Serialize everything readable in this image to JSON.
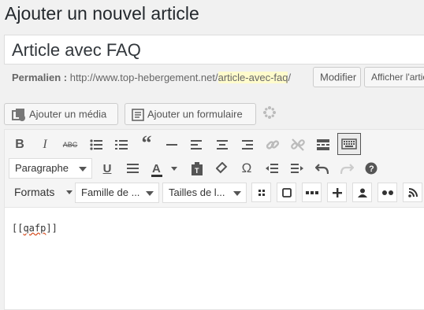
{
  "page_title": "Ajouter un nouvel article",
  "post_title": "Article avec FAQ",
  "permalink": {
    "label": "Permalien :",
    "base": "http://www.top-hebergement.net/",
    "slug": "article-avec-faq",
    "trailing": "/",
    "edit_button": "Modifier",
    "view_button": "Afficher l'article"
  },
  "media": {
    "add_media": "Ajouter un média",
    "add_form": "Ajouter un formulaire"
  },
  "toolbar": {
    "row1_icons": [
      "bold-icon",
      "italic-icon",
      "strikethrough-icon",
      "bullet-list-icon",
      "numbered-list-icon",
      "blockquote-icon",
      "horizontal-rule-icon",
      "align-left-icon",
      "align-center-icon",
      "align-right-icon",
      "link-icon",
      "unlink-icon",
      "read-more-icon",
      "toolbar-toggle-icon"
    ],
    "paragraph": "Paragraphe",
    "formats": "Formats",
    "font_family": "Famille de ...",
    "font_size": "Tailles de l..."
  },
  "content": {
    "shortcode_open": "[[",
    "shortcode_word": "qafp",
    "shortcode_close": "]]"
  }
}
